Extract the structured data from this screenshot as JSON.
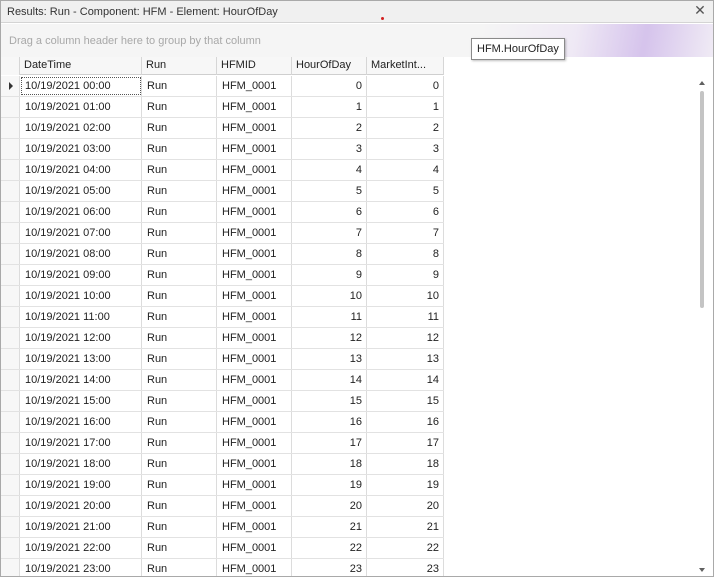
{
  "window": {
    "title": "Results: Run - Component: HFM - Element: HourOfDay",
    "close_icon": "close-icon",
    "close_glyph": "✕"
  },
  "group_panel": {
    "hint": "Drag a column header here to group by that column"
  },
  "tooltip": {
    "text": "HFM.HourOfDay"
  },
  "columns": [
    "DateTime",
    "Run",
    "HFMID",
    "HourOfDay",
    "MarketInt..."
  ],
  "rows": [
    [
      "10/19/2021 00:00",
      "Run",
      "HFM_0001",
      "0",
      "0"
    ],
    [
      "10/19/2021 01:00",
      "Run",
      "HFM_0001",
      "1",
      "1"
    ],
    [
      "10/19/2021 02:00",
      "Run",
      "HFM_0001",
      "2",
      "2"
    ],
    [
      "10/19/2021 03:00",
      "Run",
      "HFM_0001",
      "3",
      "3"
    ],
    [
      "10/19/2021 04:00",
      "Run",
      "HFM_0001",
      "4",
      "4"
    ],
    [
      "10/19/2021 05:00",
      "Run",
      "HFM_0001",
      "5",
      "5"
    ],
    [
      "10/19/2021 06:00",
      "Run",
      "HFM_0001",
      "6",
      "6"
    ],
    [
      "10/19/2021 07:00",
      "Run",
      "HFM_0001",
      "7",
      "7"
    ],
    [
      "10/19/2021 08:00",
      "Run",
      "HFM_0001",
      "8",
      "8"
    ],
    [
      "10/19/2021 09:00",
      "Run",
      "HFM_0001",
      "9",
      "9"
    ],
    [
      "10/19/2021 10:00",
      "Run",
      "HFM_0001",
      "10",
      "10"
    ],
    [
      "10/19/2021 11:00",
      "Run",
      "HFM_0001",
      "11",
      "11"
    ],
    [
      "10/19/2021 12:00",
      "Run",
      "HFM_0001",
      "12",
      "12"
    ],
    [
      "10/19/2021 13:00",
      "Run",
      "HFM_0001",
      "13",
      "13"
    ],
    [
      "10/19/2021 14:00",
      "Run",
      "HFM_0001",
      "14",
      "14"
    ],
    [
      "10/19/2021 15:00",
      "Run",
      "HFM_0001",
      "15",
      "15"
    ],
    [
      "10/19/2021 16:00",
      "Run",
      "HFM_0001",
      "16",
      "16"
    ],
    [
      "10/19/2021 17:00",
      "Run",
      "HFM_0001",
      "17",
      "17"
    ],
    [
      "10/19/2021 18:00",
      "Run",
      "HFM_0001",
      "18",
      "18"
    ],
    [
      "10/19/2021 19:00",
      "Run",
      "HFM_0001",
      "19",
      "19"
    ],
    [
      "10/19/2021 20:00",
      "Run",
      "HFM_0001",
      "20",
      "20"
    ],
    [
      "10/19/2021 21:00",
      "Run",
      "HFM_0001",
      "21",
      "21"
    ],
    [
      "10/19/2021 22:00",
      "Run",
      "HFM_0001",
      "22",
      "22"
    ],
    [
      "10/19/2021 23:00",
      "Run",
      "HFM_0001",
      "23",
      "23"
    ]
  ],
  "focused_row": 0,
  "accent_color": "#d21f1f"
}
